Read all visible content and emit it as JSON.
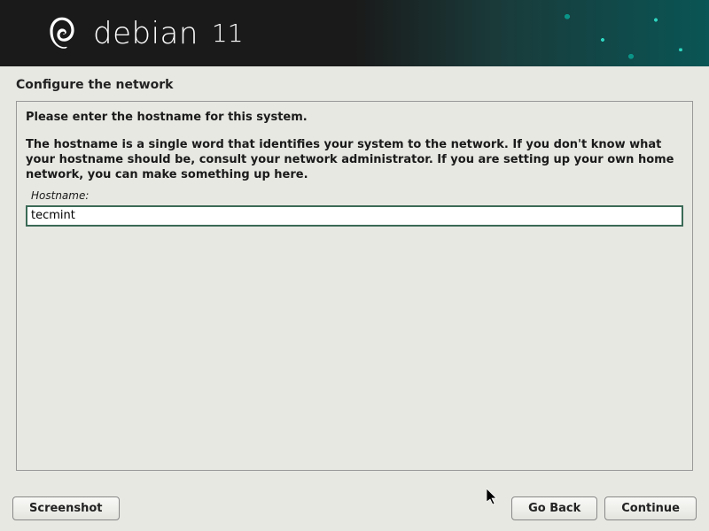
{
  "banner": {
    "brand": "debian",
    "version": "11"
  },
  "section_title": "Configure the network",
  "panel": {
    "instruction": "Please enter the hostname for this system.",
    "description": "The hostname is a single word that identifies your system to the network. If you don't know what your hostname should be, consult your network administrator. If you are setting up your own home network, you can make something up here.",
    "field_label": "Hostname:",
    "hostname_value": "tecmint"
  },
  "footer": {
    "screenshot": "Screenshot",
    "go_back": "Go Back",
    "continue": "Continue"
  }
}
